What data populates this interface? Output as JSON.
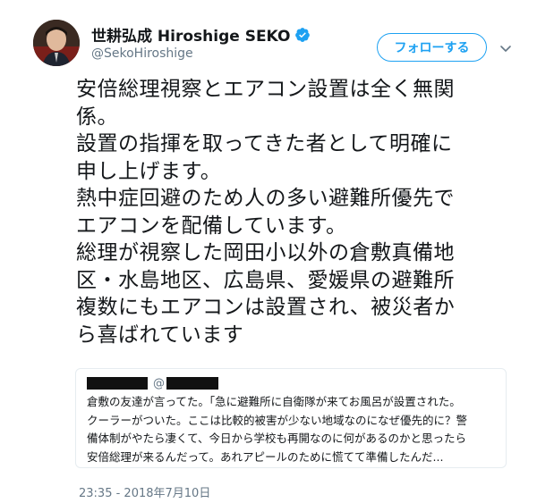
{
  "author": {
    "display_name": "世耕弘成 Hiroshige SEKO",
    "handle": "@SekoHiroshige",
    "verified": true
  },
  "follow_button": {
    "label": "フォローする"
  },
  "tweet": {
    "lines": [
      "安倍総理視察とエアコン設置は全く無関",
      "係。",
      "設置の指揮を取ってきた者として明確に",
      "申し上げます。",
      "熱中症回避のため人の多い避難所優先で",
      "エアコンを配備しています。",
      "総理が視察した岡田小以外の倉敷真備地",
      "区・水島地区、広島県、愛媛県の避難所",
      "複数にもエアコンは設置され、被災者か",
      "ら喜ばれています"
    ]
  },
  "quote": {
    "at_symbol": "@",
    "lines": [
      "倉敷の友達が言ってた。「急に避難所に自衛隊が来てお風呂が設置された。",
      "クーラーがついた。ここは比較的被害が少ない地域なのになぜ優先的に？警",
      "備体制がやたら凄くて、今日から学校も再開なのに何があるのかと思ったら",
      "安倍総理が来るんだって。あれアピールのために慌てて準備したんだ..."
    ]
  },
  "timestamp": "23:35 - 2018年7月10日",
  "colors": {
    "accent": "#1da1f2",
    "text": "#14171a",
    "muted": "#657786",
    "border": "#e6ecf0"
  },
  "icons": {
    "verified": "verified-badge-icon",
    "caret": "chevron-down-icon"
  }
}
